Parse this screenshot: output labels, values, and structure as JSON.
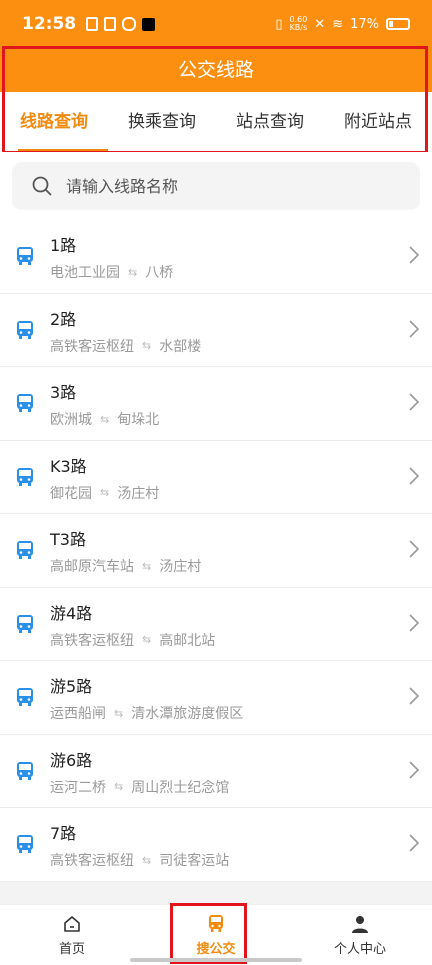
{
  "status": {
    "time": "12:58",
    "net_speed_top": "0.60",
    "net_speed_bottom": "KB/s",
    "battery": "17%"
  },
  "header": {
    "title": "公交线路"
  },
  "tabs": [
    {
      "label": "线路查询",
      "active": true
    },
    {
      "label": "换乘查询",
      "active": false
    },
    {
      "label": "站点查询",
      "active": false
    },
    {
      "label": "附近站点",
      "active": false
    }
  ],
  "search": {
    "placeholder": "请输入线路名称"
  },
  "routes": [
    {
      "name": "1路",
      "from": "电池工业园",
      "to": "八桥"
    },
    {
      "name": "2路",
      "from": "高铁客运枢纽",
      "to": "水部楼"
    },
    {
      "name": "3路",
      "from": "欧洲城",
      "to": "甸垛北"
    },
    {
      "name": "K3路",
      "from": "御花园",
      "to": "汤庄村"
    },
    {
      "name": "T3路",
      "from": "高邮原汽车站",
      "to": "汤庄村"
    },
    {
      "name": "游4路",
      "from": "高铁客运枢纽",
      "to": "高邮北站"
    },
    {
      "name": "游5路",
      "from": "运西船闸",
      "to": "清水潭旅游度假区"
    },
    {
      "name": "游6路",
      "from": "运河二桥",
      "to": "周山烈士纪念馆"
    },
    {
      "name": "7路",
      "from": "高铁客运枢纽",
      "to": "司徒客运站"
    }
  ],
  "swap_symbol": "⇆",
  "nav": [
    {
      "label": "首页",
      "icon": "home-icon"
    },
    {
      "label": "搜公交",
      "icon": "bus-icon",
      "active": true
    },
    {
      "label": "个人中心",
      "icon": "person-icon"
    }
  ],
  "colors": {
    "brand": "#fd8f10",
    "accent": "#f18b10",
    "bus_icon": "#2a8fe6",
    "highlight": "#e0161c"
  }
}
